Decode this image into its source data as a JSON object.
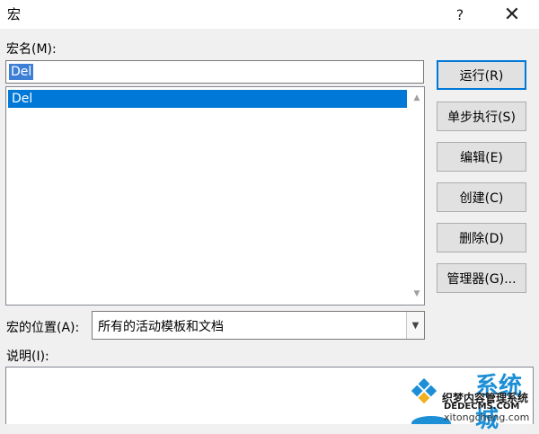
{
  "window": {
    "title": "宏",
    "help": "?",
    "close": "✕"
  },
  "macro_name": {
    "label": "宏名(M):",
    "value": "Del"
  },
  "macro_list": {
    "items": [
      "Del"
    ]
  },
  "buttons": {
    "run": "运行(R)",
    "step": "单步执行(S)",
    "edit": "编辑(E)",
    "create": "创建(C)",
    "delete": "删除(D)",
    "organizer": "管理器(G)..."
  },
  "location": {
    "label": "宏的位置(A):",
    "value": "所有的活动模板和文档"
  },
  "description": {
    "label": "说明(I):"
  },
  "watermark": {
    "brand": "系统城",
    "line1": "织梦内容管理系统",
    "line2": "DEDECMS.COM",
    "line3": "xitongcheng.com"
  }
}
